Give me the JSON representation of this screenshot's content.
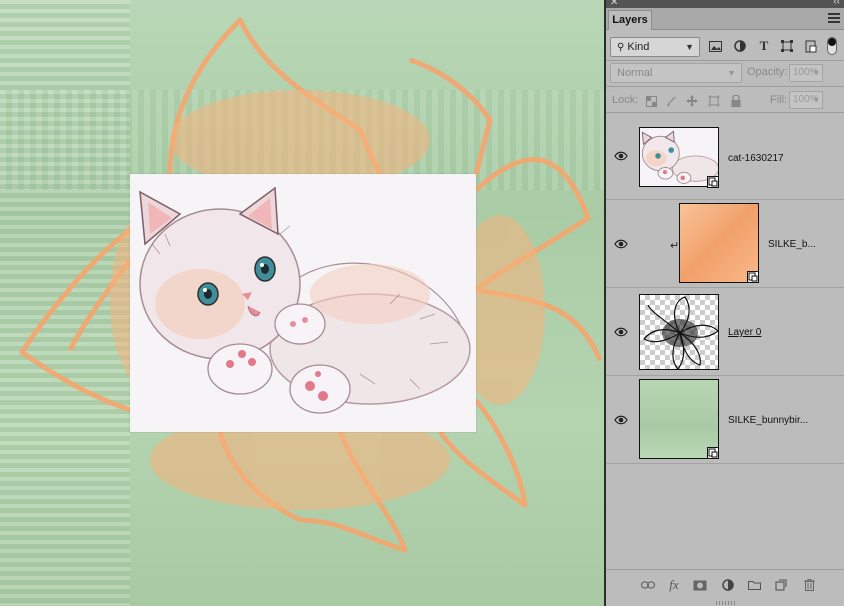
{
  "panel": {
    "tab_label": "Layers",
    "filter": {
      "kind_label": "Kind"
    },
    "blend_mode": "Normal",
    "opacity": {
      "label": "Opacity:",
      "value": "100%"
    },
    "lock": {
      "label": "Lock:"
    },
    "fill": {
      "label": "Fill:",
      "value": "100%"
    },
    "layers": [
      {
        "name": "cat-1630217",
        "visible": true,
        "type": "smart-object"
      },
      {
        "name": "SILKE_b...",
        "visible": true,
        "type": "smart-object",
        "clipped": true
      },
      {
        "name": "Layer 0",
        "visible": true,
        "type": "pixel"
      },
      {
        "name": "SILKE_bunnybir...",
        "visible": true,
        "type": "smart-object"
      }
    ],
    "footer_icons": [
      "link-icon",
      "fx-icon",
      "mask-icon",
      "adjustment-icon",
      "folder-icon",
      "new-layer-icon",
      "trash-icon"
    ]
  },
  "colors": {
    "canvas_green": "#b2d3ae",
    "flower_orange": "#f6a56e",
    "panel_bg": "#bcbcbc"
  }
}
